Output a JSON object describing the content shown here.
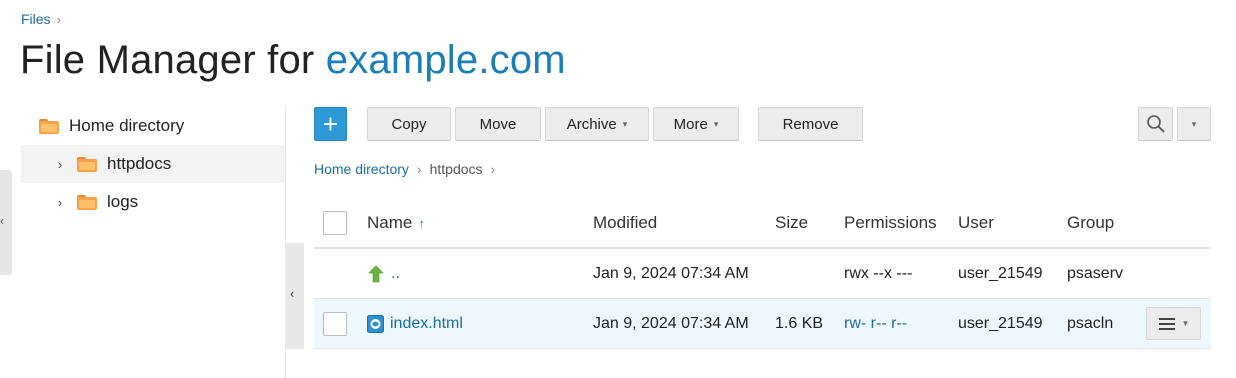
{
  "breadcrumb_top": {
    "label": "Files"
  },
  "title": {
    "prefix": "File Manager for ",
    "domain": "example.com"
  },
  "tree": [
    {
      "label": "Home directory"
    },
    {
      "label": "httpdocs"
    },
    {
      "label": "logs"
    }
  ],
  "toolbar": {
    "add": "+",
    "copy": "Copy",
    "move": "Move",
    "archive": "Archive",
    "more": "More",
    "remove": "Remove"
  },
  "path": {
    "root": "Home directory",
    "current": "httpdocs"
  },
  "table": {
    "headers": {
      "name": "Name",
      "modified": "Modified",
      "size": "Size",
      "permissions": "Permissions",
      "user": "User",
      "group": "Group"
    },
    "rows": [
      {
        "name": "..",
        "modified": "Jan 9, 2024 07:34 AM",
        "size": "",
        "permissions": "rwx --x ---",
        "user": "user_21549",
        "group": "psaserv"
      },
      {
        "name": "index.html",
        "modified": "Jan 9, 2024 07:34 AM",
        "size": "1.6 KB",
        "permissions": "rw- r-- r--",
        "user": "user_21549",
        "group": "psacln"
      }
    ]
  },
  "colors": {
    "link": "#1a6e9e",
    "accent": "#2d9ad6",
    "folder": "#f5a24a",
    "up_arrow": "#6cb33f"
  }
}
